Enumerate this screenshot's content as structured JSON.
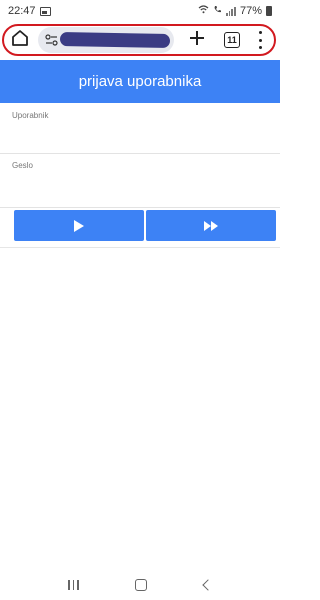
{
  "status_bar": {
    "time": "22:47",
    "battery_text": "77%",
    "icons": [
      "image-icon",
      "wifi-icon",
      "call-icon",
      "signal-icon",
      "battery-icon"
    ]
  },
  "browser": {
    "tab_count": "11",
    "icons": [
      "home-icon",
      "site-settings-icon",
      "new-tab-icon",
      "tabs-icon",
      "menu-icon"
    ],
    "highlight_color": "#d2191f",
    "url_redaction_color": "#3b3c84"
  },
  "app": {
    "title": "prijava uporabnika",
    "accent_color": "#3d82f5",
    "fields": {
      "username_label": "Uporabnik",
      "username_value": "",
      "password_label": "Geslo",
      "password_value": ""
    },
    "buttons": {
      "play_icon": "play-icon",
      "fast_forward_icon": "fast-forward-icon"
    }
  },
  "nav_bar": {
    "icons": [
      "recents-icon",
      "home-icon",
      "back-icon"
    ]
  }
}
